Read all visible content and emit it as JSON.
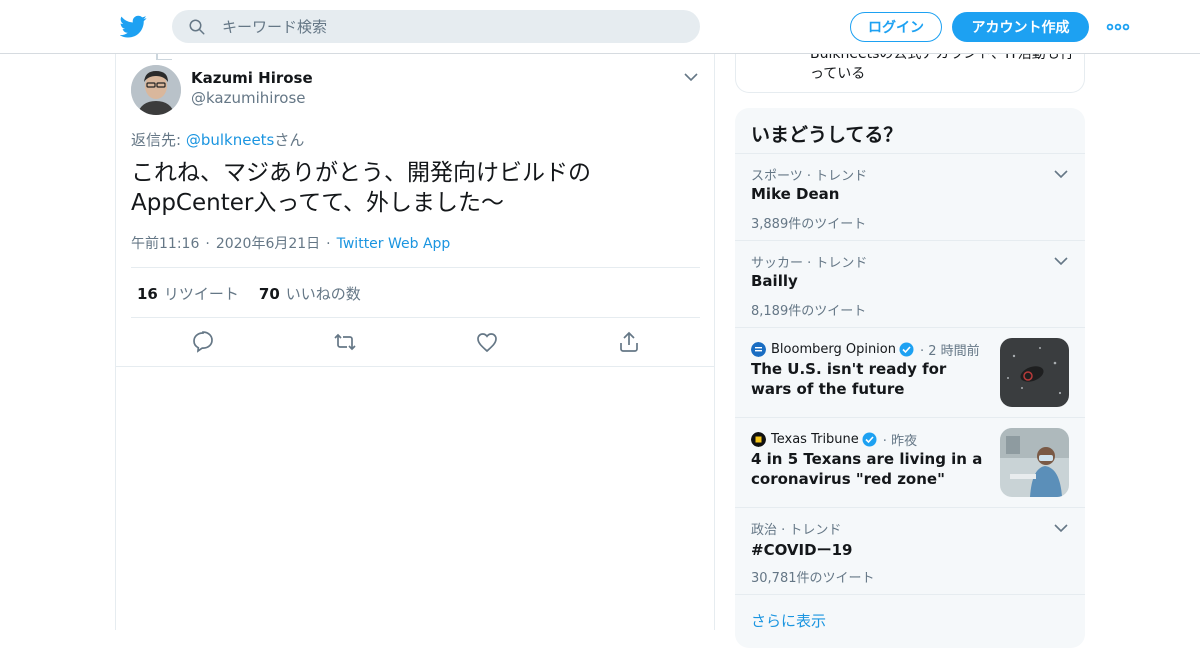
{
  "header": {
    "search_placeholder": "キーワード検索",
    "login_label": "ログイン",
    "signup_label": "アカウント作成",
    "accent_color": "#1da1f2"
  },
  "tweet": {
    "author_name": "Kazumi Hirose",
    "author_handle": "@kazumihirose",
    "replying_prefix": "返信先: ",
    "replying_to": "@bulkneets",
    "replying_suffix": "さん",
    "text_line1": "これね、マジありがとう、開発向けビルドの",
    "text_line2": "AppCenter入ってて、外しました～",
    "time": "午前11:16",
    "date": "2020年6月21日",
    "source": "Twitter Web App",
    "retweet_count": "16",
    "retweet_label": "リツイート",
    "like_count": "70",
    "like_label": "いいねの数",
    "icons": [
      "reply-icon",
      "retweet-icon",
      "like-icon",
      "share-icon"
    ]
  },
  "sidebar": {
    "prev_card_text": "Bulkneetsの公式アカウント、IT活動も行っている",
    "trends_title": "いまどうしてる？",
    "trends": [
      {
        "context": "スポーツ · トレンド",
        "name": "Mike Dean",
        "count": "3,889件のツイート"
      },
      {
        "context": "サッカー · トレンド",
        "name": "Bailly",
        "count": "8,189件のツイート"
      }
    ],
    "news": [
      {
        "source": "Bloomberg Opinion",
        "when": "2 時間前",
        "title": "The U.S. isn't ready for wars of the future"
      },
      {
        "source": "Texas Tribune",
        "when": "昨夜",
        "title": "4 in 5 Texans are living in a coronavirus \"red zone\""
      }
    ],
    "trend_last": {
      "context": "政治 · トレンド",
      "name": "#COVIDー19",
      "count": "30,781件のツイート"
    },
    "show_more": "さらに表示"
  }
}
